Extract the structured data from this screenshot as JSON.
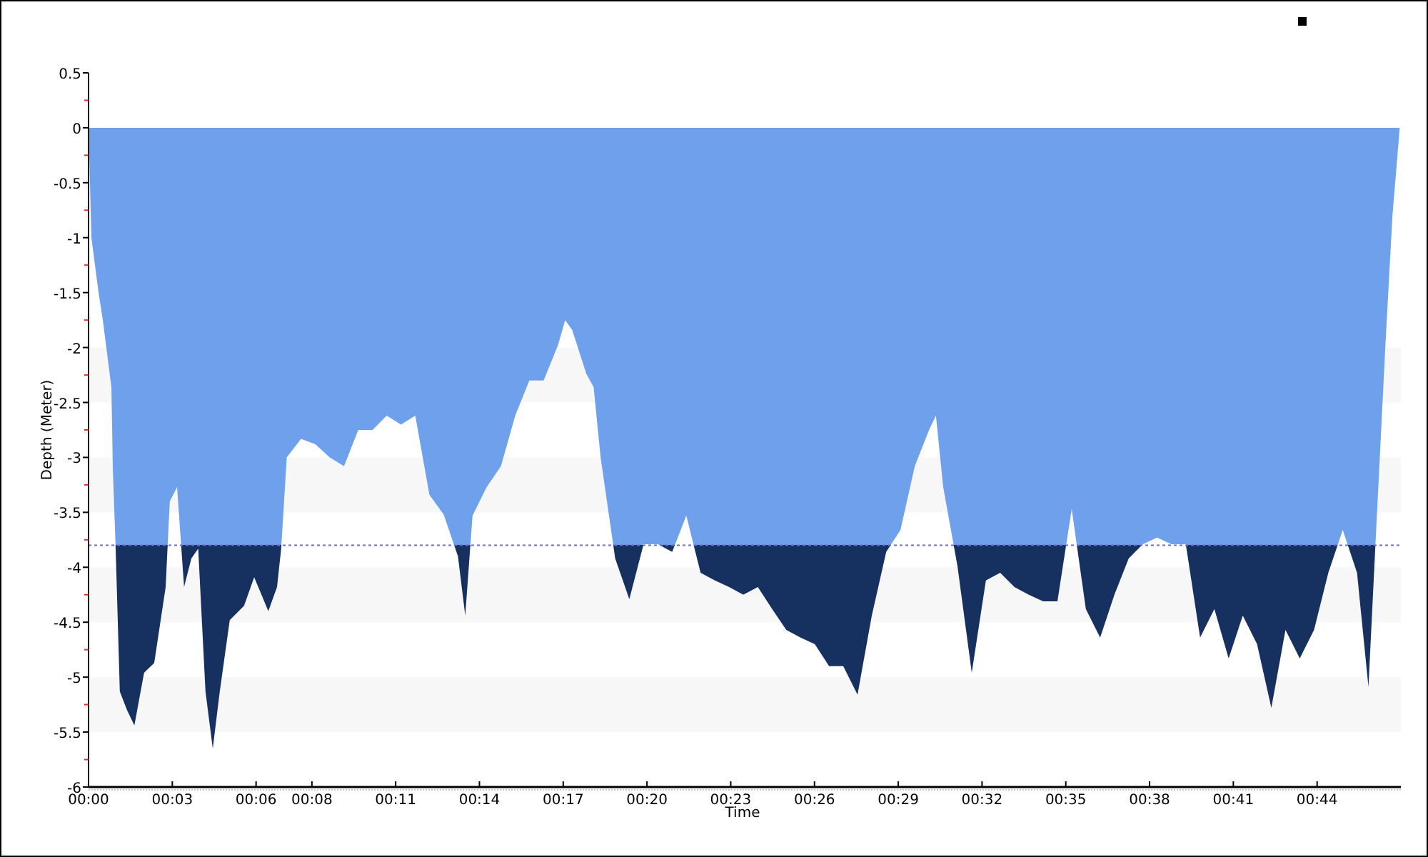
{
  "chart_data": {
    "type": "area",
    "xlabel": "Time",
    "ylabel": "Depth (Meter)",
    "x": [
      0,
      0.1,
      0.36,
      0.51,
      0.82,
      0.87,
      0.97,
      1.12,
      1.38,
      1.64,
      1.99,
      2.35,
      2.76,
      2.91,
      3.17,
      3.42,
      3.68,
      3.93,
      4.19,
      4.45,
      4.7,
      5.06,
      5.57,
      5.93,
      6.44,
      6.75,
      6.9,
      7.1,
      7.61,
      8.12,
      8.64,
      9.15,
      9.66,
      10.17,
      10.68,
      11.19,
      11.7,
      12.21,
      12.72,
      13.23,
      13.49,
      13.75,
      14.26,
      14.77,
      15.28,
      15.79,
      16.3,
      16.81,
      17.07,
      17.32,
      17.83,
      18.09,
      18.34,
      18.86,
      19.37,
      19.88,
      20.39,
      20.9,
      21.41,
      21.92,
      22.43,
      22.94,
      23.45,
      23.97,
      24.48,
      24.99,
      25.5,
      26.01,
      26.52,
      27.03,
      27.54,
      28.05,
      28.57,
      29.08,
      29.59,
      30.1,
      30.35,
      30.61,
      31.12,
      31.63,
      32.14,
      32.65,
      33.16,
      33.67,
      34.19,
      34.7,
      35.21,
      35.72,
      36.23,
      36.74,
      37.25,
      37.76,
      38.27,
      38.78,
      39.3,
      39.81,
      40.32,
      40.83,
      41.34,
      41.85,
      42.36,
      42.87,
      43.38,
      43.89,
      44.4,
      44.92,
      45.43,
      45.84,
      46.09,
      46.45,
      46.7,
      46.96
    ],
    "series": [
      {
        "color": "#6fa0ec",
        "values": [
          0,
          -1.0,
          -1.5,
          -1.75,
          -2.36,
          -3.1,
          -3.83,
          -5.13,
          -5.3,
          -5.44,
          -4.96,
          -4.87,
          -4.18,
          -3.4,
          -3.27,
          -4.18,
          -3.92,
          -3.83,
          -5.13,
          -5.65,
          -5.13,
          -4.48,
          -4.35,
          -4.09,
          -4.4,
          -4.18,
          -3.83,
          -3.0,
          -2.83,
          -2.88,
          -3.0,
          -3.08,
          -2.75,
          -2.75,
          -2.62,
          -2.7,
          -2.62,
          -3.34,
          -3.52,
          -3.9,
          -4.44,
          -3.53,
          -3.27,
          -3.08,
          -2.62,
          -2.3,
          -2.3,
          -1.98,
          -1.75,
          -1.84,
          -2.24,
          -2.36,
          -3.0,
          -3.92,
          -4.29,
          -3.79,
          -3.79,
          -3.86,
          -3.53,
          -4.05,
          -4.12,
          -4.18,
          -4.25,
          -4.18,
          -4.38,
          -4.57,
          -4.64,
          -4.7,
          -4.9,
          -4.9,
          -5.16,
          -4.44,
          -3.86,
          -3.66,
          -3.08,
          -2.75,
          -2.62,
          -3.27,
          -3.99,
          -4.96,
          -4.12,
          -4.05,
          -4.18,
          -4.25,
          -4.31,
          -4.31,
          -3.47,
          -4.38,
          -4.64,
          -4.25,
          -3.92,
          -3.79,
          -3.73,
          -3.79,
          -3.79,
          -4.64,
          -4.38,
          -4.83,
          -4.44,
          -4.7,
          -5.28,
          -4.57,
          -4.83,
          -4.57,
          -4.05,
          -3.66,
          -4.05,
          -5.09,
          -3.79,
          -1.97,
          -0.8,
          0
        ]
      }
    ],
    "xlim": [
      0,
      47
    ],
    "ylim": [
      -6,
      0.5
    ],
    "xticks": [
      {
        "value": 0,
        "label": "00:00"
      },
      {
        "value": 3,
        "label": "00:03"
      },
      {
        "value": 6,
        "label": "00:06"
      },
      {
        "value": 8,
        "label": "00:08"
      },
      {
        "value": 11,
        "label": "00:11"
      },
      {
        "value": 14,
        "label": "00:14"
      },
      {
        "value": 17,
        "label": "00:17"
      },
      {
        "value": 20,
        "label": "00:20"
      },
      {
        "value": 23,
        "label": "00:23"
      },
      {
        "value": 26,
        "label": "00:26"
      },
      {
        "value": 29,
        "label": "00:29"
      },
      {
        "value": 32,
        "label": "00:32"
      },
      {
        "value": 35,
        "label": "00:35"
      },
      {
        "value": 38,
        "label": "00:38"
      },
      {
        "value": 41,
        "label": "00:41"
      },
      {
        "value": 44,
        "label": "00:44"
      }
    ],
    "yticks": [
      0.5,
      0,
      -0.5,
      -1,
      -1.5,
      -2,
      -2.5,
      -3,
      -3.5,
      -4,
      -4.5,
      -5,
      -5.5,
      -6
    ],
    "ref_lines": [
      {
        "axis": "y",
        "value": -3.8
      }
    ]
  }
}
